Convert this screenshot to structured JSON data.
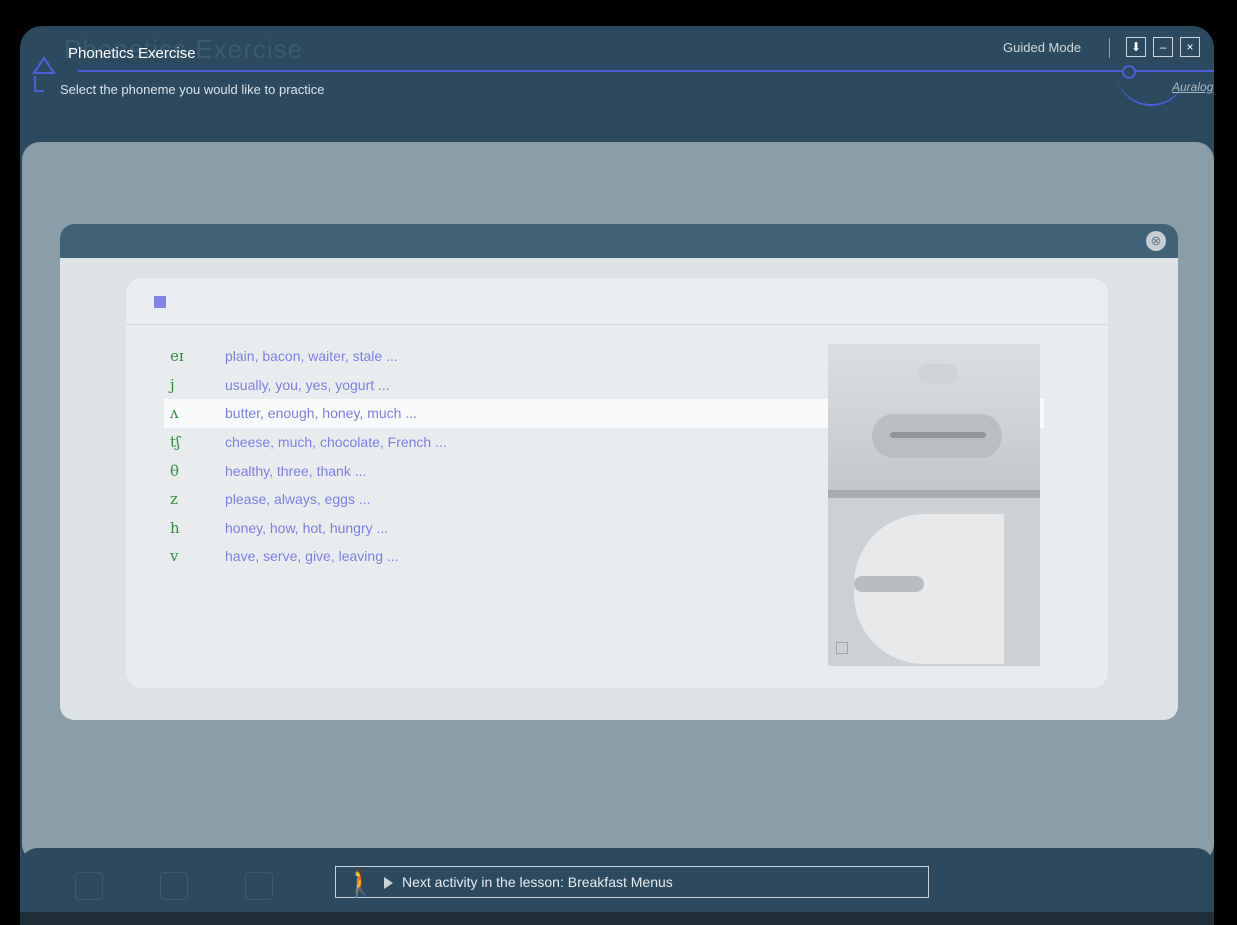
{
  "header": {
    "title": "Phonetics Exercise",
    "ghost_title": "Phonetics Exercise",
    "subtitle": "Select the phoneme you would like to practice",
    "mode_label": "Guided Mode",
    "buttons": {
      "download": "⬇",
      "minimize": "–",
      "close": "×"
    },
    "logo": "Auralog"
  },
  "modal": {
    "close_icon": "⊗",
    "phonemes": [
      {
        "symbol": "eɪ",
        "words": "plain, bacon, waiter, stale ..."
      },
      {
        "symbol": "j",
        "words": "usually, you, yes, yogurt ..."
      },
      {
        "symbol": "ʌ",
        "words": "butter, enough, honey, much ..."
      },
      {
        "symbol": "tʃ",
        "words": "cheese, much, chocolate, French ..."
      },
      {
        "symbol": "θ",
        "words": "healthy, three, thank ..."
      },
      {
        "symbol": "z",
        "words": "please, always, eggs ..."
      },
      {
        "symbol": "h",
        "words": "honey, how, hot, hungry ..."
      },
      {
        "symbol": "v",
        "words": "have, serve, give, leaving ..."
      }
    ],
    "selected_index": 2
  },
  "footer": {
    "next_activity": "Next activity in the lesson: Breakfast Menus",
    "walker_icon": "walking-person-icon"
  }
}
